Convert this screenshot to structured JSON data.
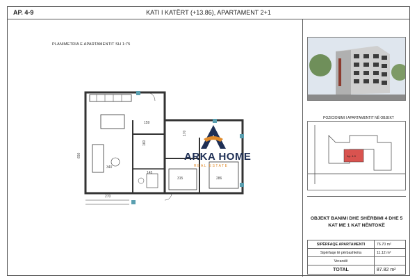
{
  "header": {
    "code": "AP. 4-9",
    "title": "KATI I KATËRT (+13.86),  APARTAMENT 2+1"
  },
  "plan": {
    "label": "PLANIMETRIA E APARTAMENTIT  SH 1:75",
    "dimensions": {
      "d1": "159",
      "d2": "650",
      "d3": "340",
      "d4": "145",
      "d5": "315",
      "d6": "286",
      "d7": "270",
      "d8": "170",
      "d9": "160"
    }
  },
  "watermark": {
    "brand_main": "ARKA HOME",
    "brand_sub": "REAL ESTATE"
  },
  "position": {
    "title": "POZICIONIMI I APARTAMENTIT NË OBJEKT",
    "unit_label": "Ap. 4-9"
  },
  "description": {
    "line1": "OBJEKT BANIMI  DHE SHËRBIMI 4 DHE 5",
    "line2": "KAT ME 1 KAT NËNTOKË"
  },
  "areas": [
    {
      "label": "SIPËRFAQE APARTAMENTI",
      "value": "76.70 m²"
    },
    {
      "label": "Sipërfaqe të përbashkëta",
      "value": "11.12 m²"
    },
    {
      "label": "Verandë",
      "value": ""
    },
    {
      "label": "TOTAL",
      "value": "87.82 m²"
    }
  ],
  "colors": {
    "accent_orange": "#e08a2a",
    "brand_navy": "#1e2f55",
    "highlight_red": "#d9534f"
  }
}
